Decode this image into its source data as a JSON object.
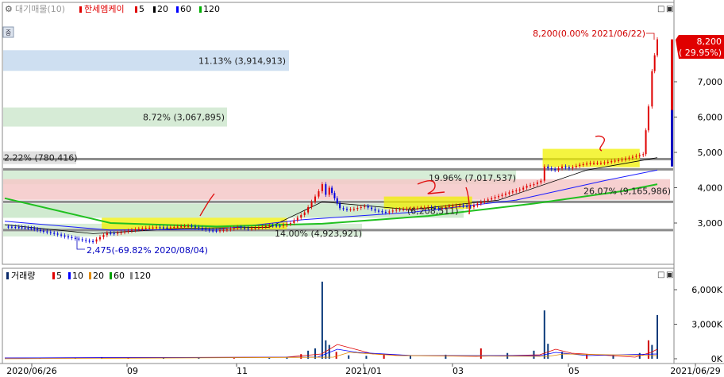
{
  "legend": {
    "cog": "⚙",
    "mode": "대기매물(10)",
    "stock": "한세엠케이",
    "ma": [
      "5",
      "20",
      "60",
      "120"
    ],
    "ma_colors": [
      "#e00000",
      "#000000",
      "#0000ff",
      "#00b000"
    ]
  },
  "volume_legend": {
    "title": "거래량",
    "ma": [
      "5",
      "10",
      "20",
      "60",
      "120"
    ],
    "ma_colors": [
      "#e00000",
      "#0000ff",
      "#e08a00",
      "#00a000",
      "#888888"
    ]
  },
  "window_buttons": {
    "maximize": "□",
    "close": "▣"
  },
  "side_icon": "중",
  "chart_data": [
    {
      "type": "candlestick",
      "title": "한세엠케이",
      "x_tick_labels": [
        "2020/06/26",
        "09",
        "11",
        "2021/01",
        "03",
        "05",
        "2021/06/29"
      ],
      "y_tick_labels": [
        "3,000",
        "4,000",
        "5,000",
        "6,000",
        "7,000"
      ],
      "ylim": [
        2200,
        8800
      ],
      "last_price": {
        "label": "8,200",
        "change": "( 29.95%)",
        "value": 8200
      },
      "annotations": {
        "high": "8,200(0.00% 2021/06/22)",
        "low": "2,475(-69.82% 2020/08/04)"
      },
      "volume_profile": [
        {
          "label": "11.13% (3,914,913)",
          "price": 7600,
          "pct": 11.13,
          "color": "#c5d9ee"
        },
        {
          "label": "8.72% (3,067,895)",
          "price": 6000,
          "pct": 8.72,
          "color": "#cfe7cf"
        },
        {
          "label": "2.22% (780,416)",
          "price": 4850,
          "pct": 2.22,
          "color": "#dcdcdc"
        },
        {
          "label": "19.96% (7,017,537)",
          "price": 4300,
          "pct": 19.96,
          "color": "#d0ead0"
        },
        {
          "label": "26.07% (9,165,986)",
          "price": 3950,
          "pct": 26.07,
          "color": "#f5c8c8"
        },
        {
          "label": "(6,208,511)",
          "price": 3350,
          "pct": 17.65,
          "color": "#c8e6c8"
        },
        {
          "label": "14.00% (4,923,921)",
          "price": 2800,
          "pct": 14.0,
          "color": "#d2ead2"
        }
      ],
      "price_path": [
        [
          0,
          2900
        ],
        [
          8,
          2880
        ],
        [
          15,
          2850
        ],
        [
          22,
          2760
        ],
        [
          28,
          2700
        ],
        [
          34,
          2620
        ],
        [
          40,
          2560
        ],
        [
          46,
          2500
        ],
        [
          50,
          2475
        ],
        [
          54,
          2600
        ],
        [
          58,
          2720
        ],
        [
          62,
          2700
        ],
        [
          68,
          2760
        ],
        [
          74,
          2820
        ],
        [
          80,
          2860
        ],
        [
          86,
          2880
        ],
        [
          92,
          2870
        ],
        [
          98,
          2900
        ],
        [
          104,
          2920
        ],
        [
          110,
          2860
        ],
        [
          116,
          2790
        ],
        [
          120,
          2780
        ],
        [
          126,
          2820
        ],
        [
          132,
          2880
        ],
        [
          138,
          2840
        ],
        [
          144,
          2880
        ],
        [
          150,
          2930
        ],
        [
          156,
          2920
        ],
        [
          162,
          3000
        ],
        [
          166,
          3150
        ],
        [
          170,
          3300
        ],
        [
          174,
          3600
        ],
        [
          178,
          3900
        ],
        [
          180,
          4100
        ],
        [
          182,
          3800
        ],
        [
          184,
          4000
        ],
        [
          187,
          3700
        ],
        [
          190,
          3420
        ],
        [
          194,
          3380
        ],
        [
          198,
          3400
        ],
        [
          204,
          3480
        ],
        [
          210,
          3350
        ],
        [
          216,
          3300
        ],
        [
          222,
          3380
        ],
        [
          228,
          3400
        ],
        [
          234,
          3420
        ],
        [
          240,
          3450
        ],
        [
          246,
          3400
        ],
        [
          252,
          3480
        ],
        [
          258,
          3500
        ],
        [
          264,
          3450
        ],
        [
          270,
          3600
        ],
        [
          276,
          3700
        ],
        [
          282,
          3800
        ],
        [
          288,
          3900
        ],
        [
          292,
          3950
        ],
        [
          296,
          4050
        ],
        [
          300,
          4100
        ],
        [
          304,
          4200
        ],
        [
          306,
          4600
        ],
        [
          308,
          4550
        ],
        [
          312,
          4500
        ],
        [
          316,
          4600
        ],
        [
          320,
          4550
        ],
        [
          326,
          4650
        ],
        [
          332,
          4700
        ],
        [
          338,
          4700
        ],
        [
          344,
          4750
        ],
        [
          350,
          4800
        ],
        [
          354,
          4850
        ],
        [
          358,
          4900
        ],
        [
          362,
          4950
        ],
        [
          365,
          6300
        ],
        [
          367,
          7300
        ],
        [
          370,
          8200
        ]
      ],
      "ma_lines": {
        "ma20": [
          [
            0,
            2950
          ],
          [
            50,
            2700
          ],
          [
            100,
            2850
          ],
          [
            150,
            2880
          ],
          [
            180,
            3600
          ],
          [
            230,
            3380
          ],
          [
            280,
            3650
          ],
          [
            330,
            4500
          ],
          [
            370,
            4850
          ]
        ],
        "ma60": [
          [
            0,
            3050
          ],
          [
            60,
            2800
          ],
          [
            120,
            2820
          ],
          [
            170,
            3100
          ],
          [
            230,
            3300
          ],
          [
            290,
            3650
          ],
          [
            340,
            4200
          ],
          [
            370,
            4500
          ]
        ],
        "ma120": [
          [
            0,
            3700
          ],
          [
            60,
            3000
          ],
          [
            120,
            2900
          ],
          [
            180,
            2980
          ],
          [
            240,
            3200
          ],
          [
            300,
            3550
          ],
          [
            350,
            3900
          ],
          [
            370,
            4100
          ]
        ]
      },
      "horizontal_levels": [
        2800,
        3600,
        4520,
        4810
      ],
      "highlight_zones": [
        {
          "x": [
            55,
            160
          ],
          "y": [
            2820,
            3150
          ]
        },
        {
          "x": [
            215,
            265
          ],
          "y": [
            3400,
            3750
          ]
        },
        {
          "x": [
            305,
            360
          ],
          "y": [
            4580,
            5100
          ]
        }
      ]
    },
    {
      "type": "bar",
      "title": "거래량",
      "y_tick_labels": [
        "6,000K",
        "3,000K",
        "0K"
      ],
      "ylim": [
        0,
        7000
      ],
      "volume": [
        [
          20,
          60
        ],
        [
          40,
          90
        ],
        [
          55,
          140
        ],
        [
          70,
          80
        ],
        [
          90,
          100
        ],
        [
          110,
          70
        ],
        [
          130,
          60
        ],
        [
          150,
          80
        ],
        [
          160,
          120
        ],
        [
          168,
          400
        ],
        [
          172,
          700
        ],
        [
          176,
          900
        ],
        [
          180,
          6700
        ],
        [
          182,
          1600
        ],
        [
          184,
          1200
        ],
        [
          188,
          600
        ],
        [
          195,
          300
        ],
        [
          205,
          250
        ],
        [
          215,
          400
        ],
        [
          230,
          300
        ],
        [
          250,
          350
        ],
        [
          270,
          900
        ],
        [
          285,
          500
        ],
        [
          300,
          700
        ],
        [
          306,
          4200
        ],
        [
          308,
          1300
        ],
        [
          316,
          600
        ],
        [
          330,
          400
        ],
        [
          345,
          300
        ],
        [
          360,
          500
        ],
        [
          365,
          1600
        ],
        [
          367,
          1200
        ],
        [
          370,
          3800
        ]
      ]
    }
  ]
}
